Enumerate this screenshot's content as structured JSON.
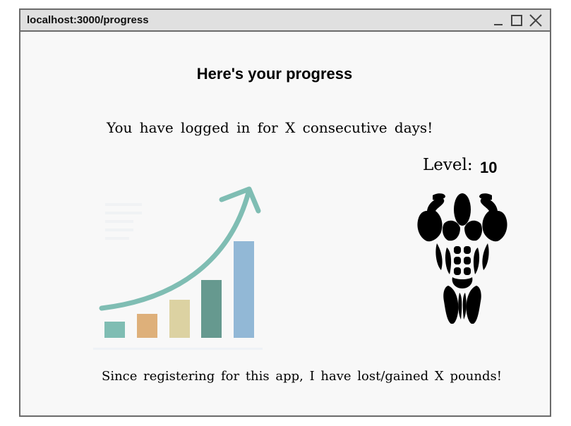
{
  "window": {
    "url": "localhost:3000/progress"
  },
  "page": {
    "heading": "Here's your progress",
    "login_message": "You have logged in for X consecutive days!",
    "level_label": "Level:",
    "level_value": "10",
    "weight_message": "Since registering for this app, I have lost/gained X pounds!"
  },
  "icons": {
    "minimize": "minimize-icon",
    "maximize": "maximize-icon",
    "close": "close-icon",
    "progress_chart": "growth-chart-illustration",
    "muscle": "muscular-torso-icon"
  },
  "colors": {
    "arrow": "#7fbdb3",
    "bar_1": "#7fbdb3",
    "bar_2": "#deb07a",
    "bar_3": "#dcd2a2",
    "bar_4": "#66998f",
    "bar_5": "#92b8d6"
  }
}
